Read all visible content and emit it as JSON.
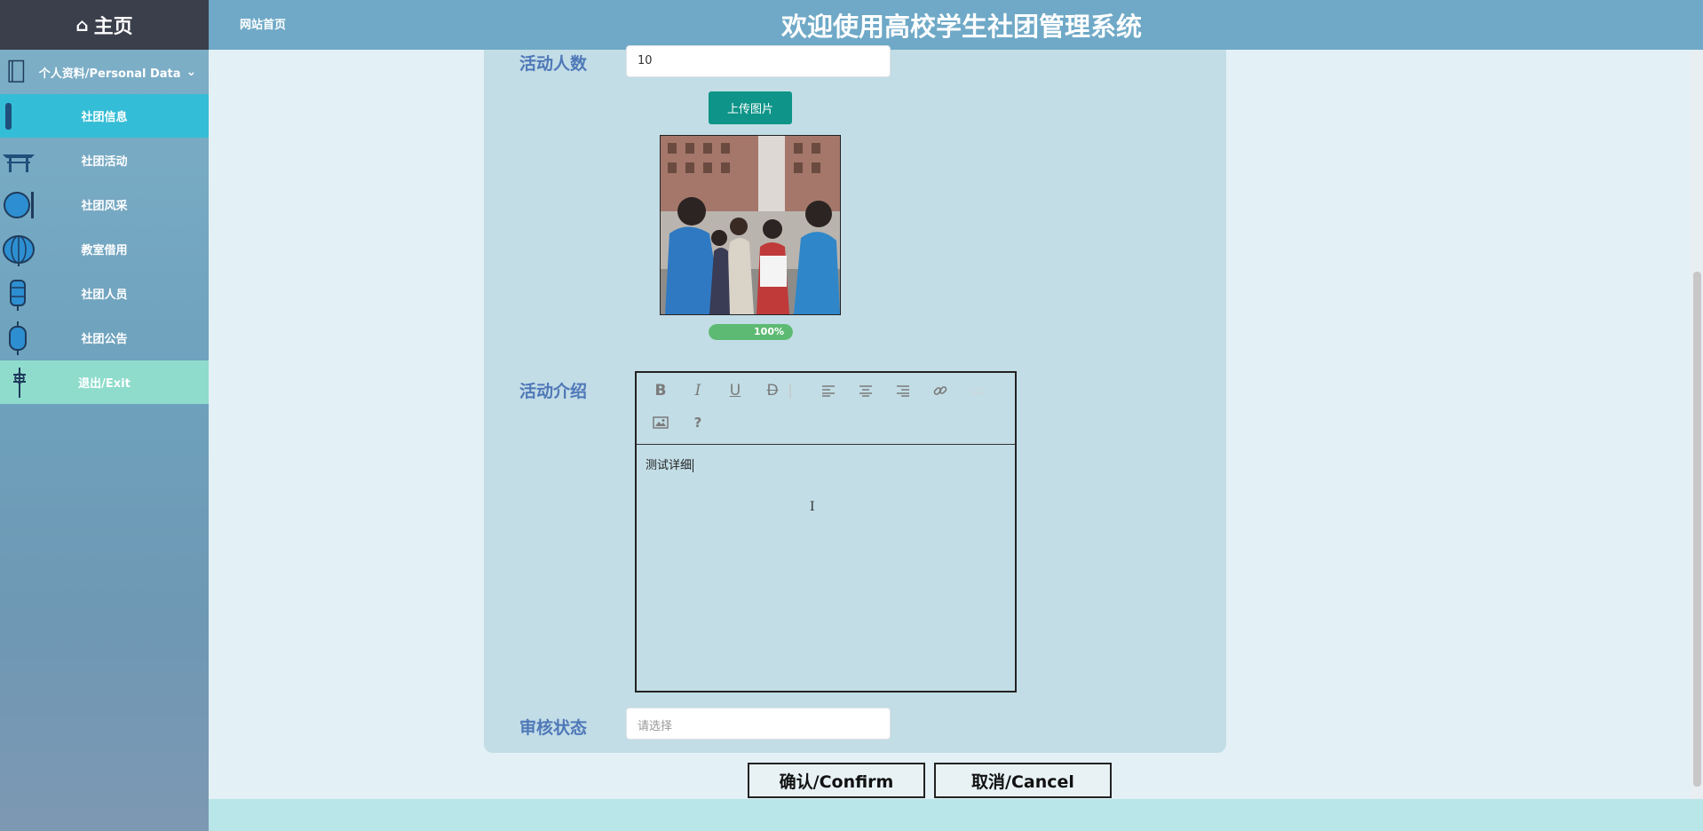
{
  "sidebar": {
    "home_label": "主页",
    "group_label": "个人资料/Personal Data",
    "items": [
      {
        "label": "社团信息",
        "icon": "scroll-icon"
      },
      {
        "label": "社团活动",
        "icon": "pavilion-icon"
      },
      {
        "label": "社团风采",
        "icon": "disc-icon"
      },
      {
        "label": "教室借用",
        "icon": "lantern-icon"
      },
      {
        "label": "社团人员",
        "icon": "tall-lantern-icon"
      },
      {
        "label": "社团公告",
        "icon": "round-lantern-icon"
      },
      {
        "label": "退出/Exit",
        "icon": "chinese-knot-icon"
      }
    ],
    "active_index": 0
  },
  "header": {
    "nav_link": "网站首页",
    "title": "欢迎使用高校学生社团管理系统"
  },
  "form": {
    "participants_label": "活动人数",
    "participants_value": "10",
    "upload_button": "上传图片",
    "upload_progress": "100%",
    "upload_progress_value": 1.0,
    "intro_label": "活动介绍",
    "intro_content": "测试详细",
    "status_label": "审核状态",
    "status_placeholder": "请选择",
    "toolbar_help": "?"
  },
  "actions": {
    "confirm": "确认/Confirm",
    "cancel": "取消/Cancel"
  },
  "colors": {
    "accent_teal": "#0e9488",
    "active_menu": "#34bdd6",
    "exit_menu": "#8fdccc",
    "header_bg": "#6fa9c7",
    "label_blue": "#4f78b8"
  }
}
